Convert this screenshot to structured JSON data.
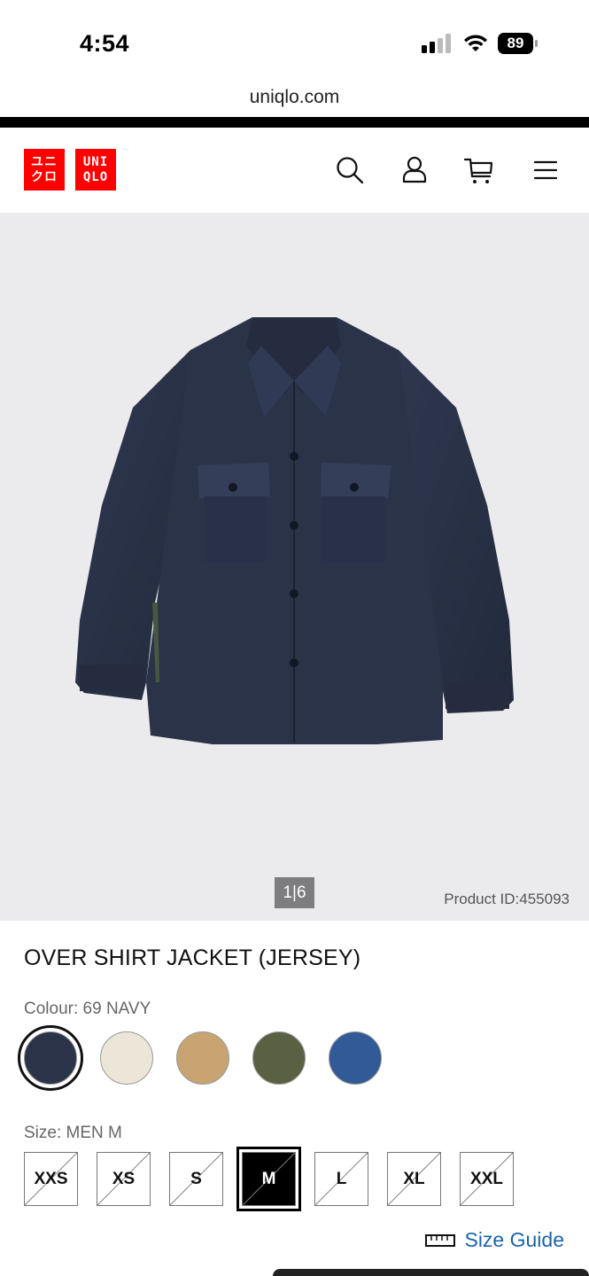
{
  "status_bar": {
    "time": "4:54",
    "battery": "89"
  },
  "browser": {
    "url": "uniqlo.com"
  },
  "header": {
    "logo_left": "ユニ\nクロ",
    "logo_right": "UNI\nQLO"
  },
  "gallery": {
    "pager": "1|6",
    "product_id": "Product ID:455093"
  },
  "product": {
    "name": "OVER SHIRT JACKET (JERSEY)",
    "colour_label": "Colour: 69 NAVY",
    "colours": [
      {
        "name": "69 NAVY",
        "hex": "#2a3347",
        "selected": true
      },
      {
        "name": "OFF WHITE",
        "hex": "#ece6d8",
        "selected": false
      },
      {
        "name": "BEIGE",
        "hex": "#c7a472",
        "selected": false
      },
      {
        "name": "OLIVE",
        "hex": "#5a6142",
        "selected": false
      },
      {
        "name": "BLUE",
        "hex": "#315a96",
        "selected": false
      }
    ],
    "size_label": "Size: MEN M",
    "sizes": [
      {
        "label": "XXS",
        "selected": false
      },
      {
        "label": "XS",
        "selected": false
      },
      {
        "label": "S",
        "selected": false
      },
      {
        "label": "M",
        "selected": true
      },
      {
        "label": "L",
        "selected": false
      },
      {
        "label": "XL",
        "selected": false
      },
      {
        "label": "XXL",
        "selected": false
      }
    ],
    "size_guide": "Size Guide"
  }
}
